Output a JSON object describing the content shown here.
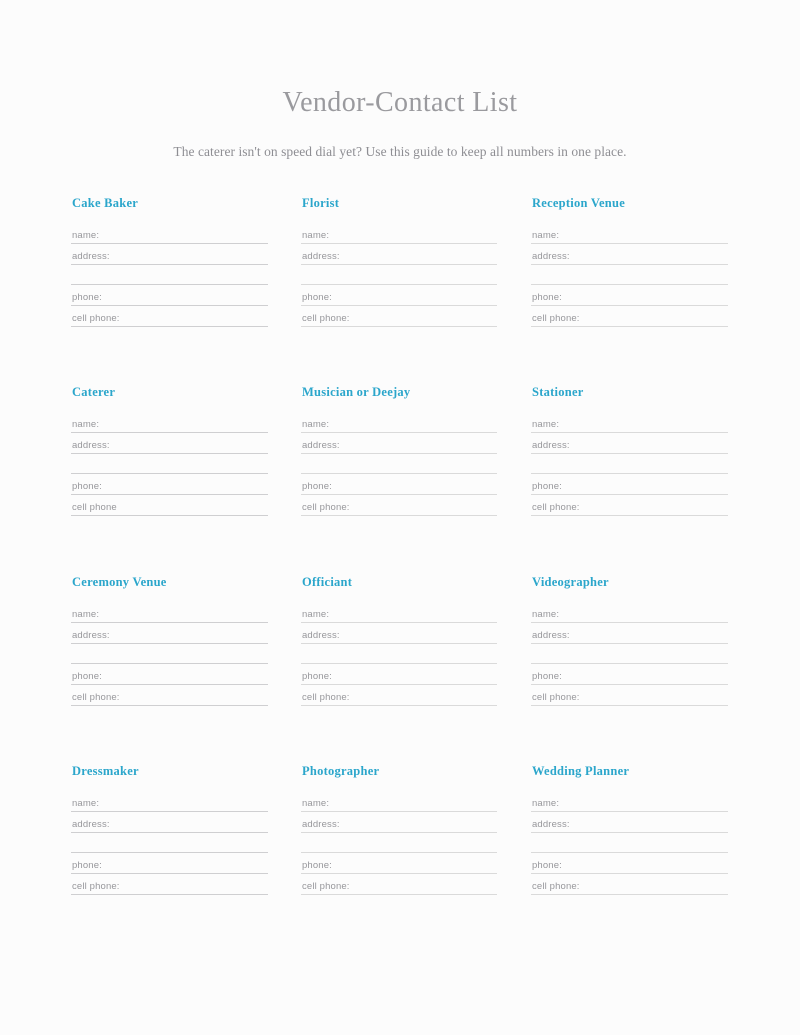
{
  "header": {
    "title": "Vendor-Contact List",
    "subtitle": "The caterer isn't on speed dial yet? Use this guide to keep all numbers in one place."
  },
  "theme": {
    "accent": "#2ba6cb",
    "title_color": "#9a9a9e",
    "label_color": "#97979b",
    "rule_color": "#d8d8d8",
    "background": "#fcfcfc"
  },
  "blocks": [
    {
      "title": "Cake Baker",
      "fields": [
        {
          "label": "name:"
        },
        {
          "label": "address:"
        },
        {
          "label": ""
        },
        {
          "label": "phone:"
        },
        {
          "label": "cell phone:"
        }
      ]
    },
    {
      "title": "Florist",
      "fields": [
        {
          "label": "name:"
        },
        {
          "label": "address:"
        },
        {
          "label": ""
        },
        {
          "label": "phone:"
        },
        {
          "label": "cell phone:"
        }
      ]
    },
    {
      "title": "Reception Venue",
      "fields": [
        {
          "label": "name:"
        },
        {
          "label": "address:"
        },
        {
          "label": ""
        },
        {
          "label": "phone:"
        },
        {
          "label": "cell phone:"
        }
      ]
    },
    {
      "title": "Caterer",
      "fields": [
        {
          "label": "name:"
        },
        {
          "label": "address:"
        },
        {
          "label": ""
        },
        {
          "label": "phone:"
        },
        {
          "label": "cell phone"
        }
      ]
    },
    {
      "title": "Musician or Deejay",
      "fields": [
        {
          "label": "name:"
        },
        {
          "label": "address:"
        },
        {
          "label": ""
        },
        {
          "label": "phone:"
        },
        {
          "label": "cell phone:"
        }
      ]
    },
    {
      "title": "Stationer",
      "fields": [
        {
          "label": "name:"
        },
        {
          "label": "address:"
        },
        {
          "label": ""
        },
        {
          "label": "phone:"
        },
        {
          "label": "cell phone:"
        }
      ]
    },
    {
      "title": "Ceremony Venue",
      "fields": [
        {
          "label": "name:"
        },
        {
          "label": "address:"
        },
        {
          "label": ""
        },
        {
          "label": "phone:"
        },
        {
          "label": "cell phone:"
        }
      ]
    },
    {
      "title": "Officiant",
      "fields": [
        {
          "label": "name:"
        },
        {
          "label": "address:"
        },
        {
          "label": ""
        },
        {
          "label": "phone:"
        },
        {
          "label": "cell phone:"
        }
      ]
    },
    {
      "title": "Videographer",
      "fields": [
        {
          "label": "name:"
        },
        {
          "label": "address:"
        },
        {
          "label": ""
        },
        {
          "label": "phone:"
        },
        {
          "label": "cell phone:"
        }
      ]
    },
    {
      "title": "Dressmaker",
      "fields": [
        {
          "label": "name:"
        },
        {
          "label": "address:"
        },
        {
          "label": ""
        },
        {
          "label": "phone:"
        },
        {
          "label": "cell phone:"
        }
      ]
    },
    {
      "title": "Photographer",
      "fields": [
        {
          "label": "name:"
        },
        {
          "label": "address:"
        },
        {
          "label": ""
        },
        {
          "label": "phone:"
        },
        {
          "label": "cell phone:"
        }
      ]
    },
    {
      "title": "Wedding Planner",
      "fields": [
        {
          "label": "name:"
        },
        {
          "label": "address:"
        },
        {
          "label": ""
        },
        {
          "label": "phone:"
        },
        {
          "label": "cell phone:"
        }
      ]
    }
  ]
}
